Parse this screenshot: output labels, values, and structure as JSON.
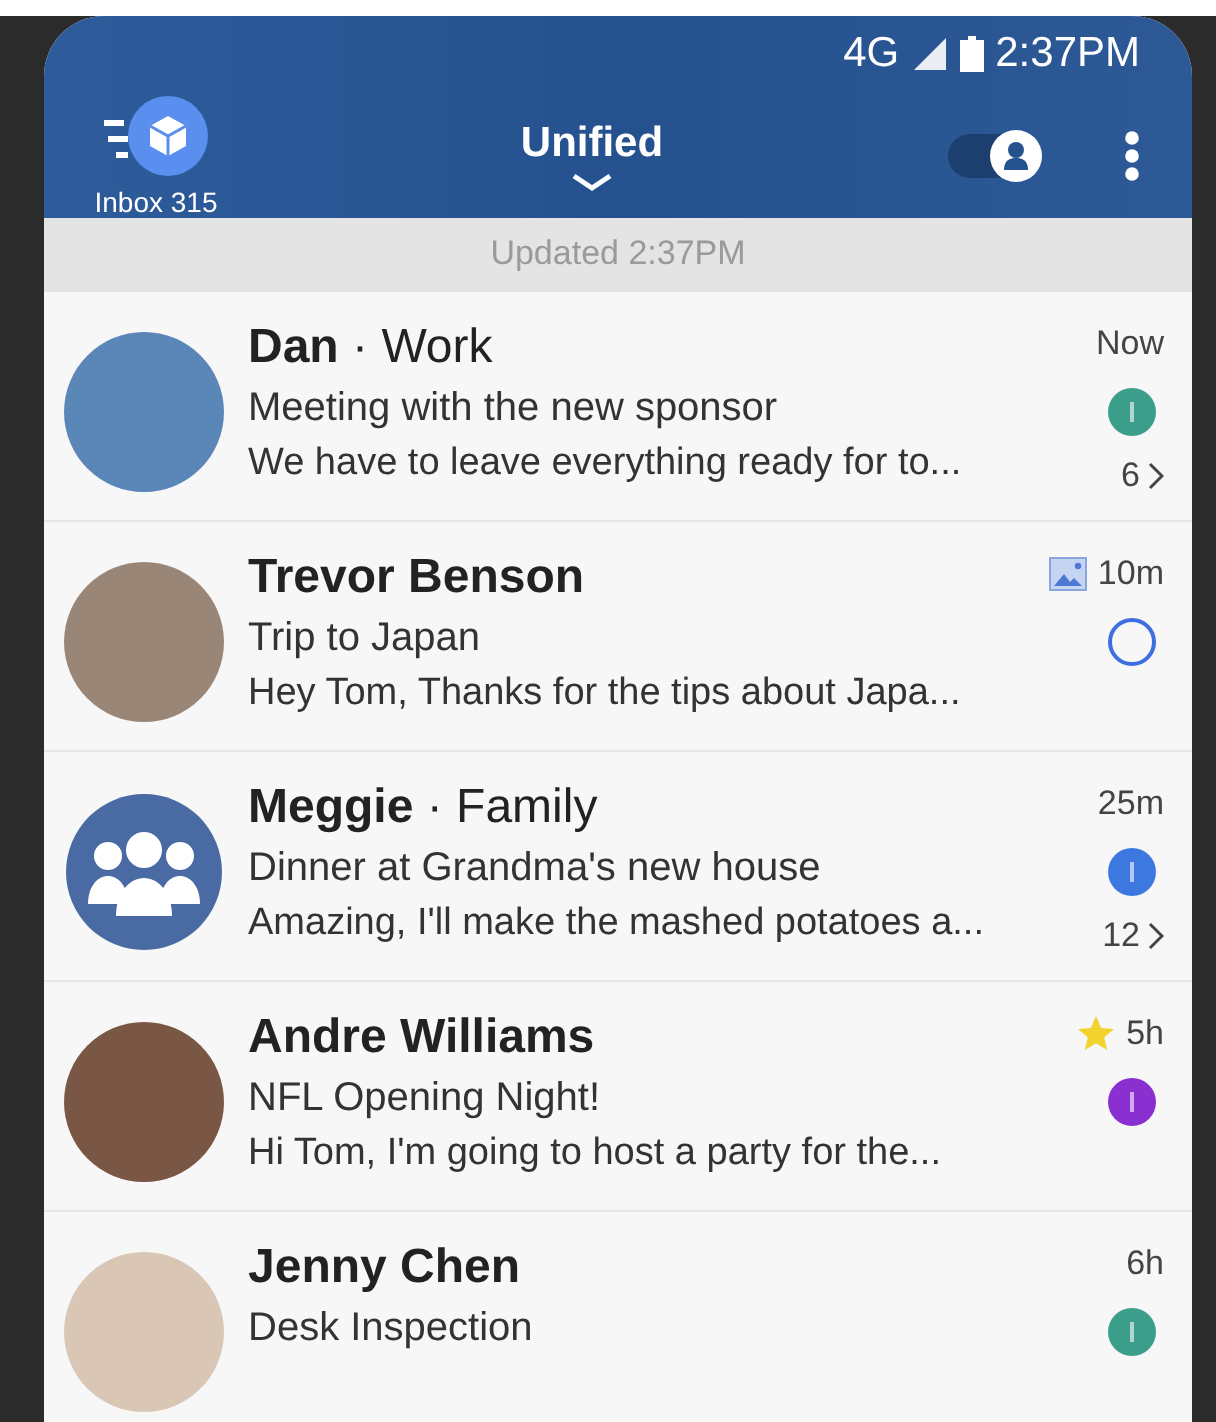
{
  "status_bar": {
    "network": "4G",
    "time": "2:37PM"
  },
  "header": {
    "inbox_label": "Inbox 315",
    "title": "Unified",
    "toggle_on": true
  },
  "updated": "Updated 2:37PM",
  "messages": [
    {
      "kind": "photo",
      "name": "Dan",
      "separator": "·",
      "label": "Work",
      "subject": "Meeting with the new sponsor",
      "preview": "We have to leave everything ready for to...",
      "time": "Now",
      "read": false,
      "color": "#3a9e8a",
      "count": "6",
      "attachment": false,
      "starred": false
    },
    {
      "kind": "photo",
      "name": "Trevor Benson",
      "subject": "Trip to Japan",
      "preview": "Hey Tom, Thanks for the tips about Japa...",
      "time": "10m",
      "read": true,
      "color": "#3d6fe0",
      "attachment": true,
      "starred": false
    },
    {
      "kind": "group",
      "name": "Meggie",
      "separator": "·",
      "label": "Family",
      "subject": "Dinner at Grandma's new house",
      "preview": "Amazing, I'll make the mashed potatoes a...",
      "time": "25m",
      "read": false,
      "color": "#3d78e0",
      "count": "12",
      "attachment": false,
      "starred": false
    },
    {
      "kind": "photo",
      "name": "Andre Williams",
      "subject": "NFL Opening Night!",
      "preview": "Hi Tom, I'm going to host a party for the...",
      "time": "5h",
      "read": false,
      "color": "#8a2fd0",
      "attachment": false,
      "starred": true
    },
    {
      "kind": "photo",
      "name": "Jenny Chen",
      "subject": "Desk Inspection",
      "time": "6h",
      "read": false,
      "color": "#3a9e8a",
      "attachment": false,
      "starred": false
    }
  ]
}
